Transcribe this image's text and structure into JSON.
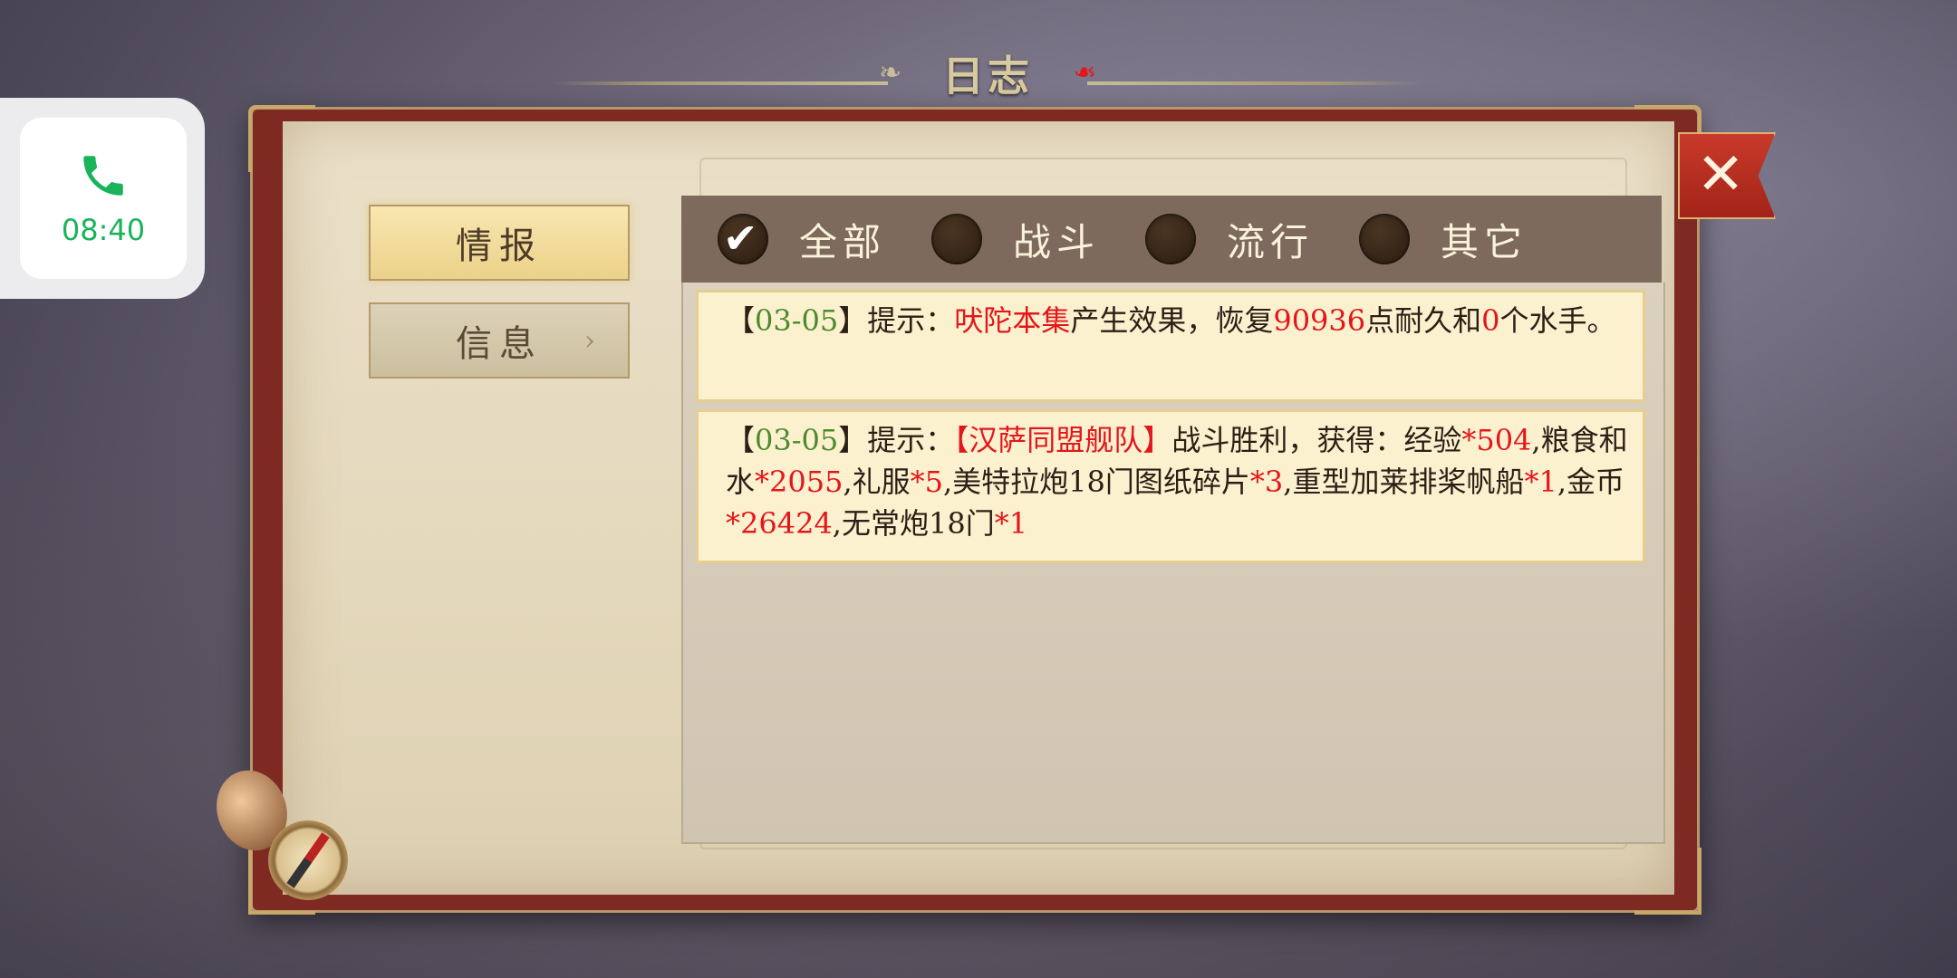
{
  "title": "日志",
  "call": {
    "time": "08:40"
  },
  "sidebar": {
    "tabs": [
      {
        "label": "情报",
        "active": true
      },
      {
        "label": "信息",
        "active": false
      }
    ]
  },
  "filters": [
    {
      "label": "全部",
      "checked": true
    },
    {
      "label": "战斗",
      "checked": false
    },
    {
      "label": "流行",
      "checked": false
    },
    {
      "label": "其它",
      "checked": false
    }
  ],
  "logs": {
    "entry1": {
      "open": "【",
      "date": "03-05",
      "close": "】",
      "prefix": "提示：",
      "item": "吠陀本集",
      "text1": "产生效果，恢复",
      "num1": "90936",
      "text2": "点耐久和",
      "num2": "0",
      "text3": "个水手。"
    },
    "entry2": {
      "open": "【",
      "date": "03-05",
      "close": "】",
      "prefix": "提示：",
      "fleet": "【汉萨同盟舰队】",
      "t1": "战斗胜利，获得：经验",
      "v1": "*504",
      "t2": ",粮食和水",
      "v2": "*2055",
      "t3": ",礼服",
      "v3": "*5",
      "t4": ",美特拉炮18门图纸碎片",
      "v4": "*3",
      "t5": ",重型加莱排桨帆船",
      "v5": "*1",
      "t6": ",金币",
      "v6": "*26424",
      "t7": ",无常炮18门",
      "v7": "*1"
    }
  },
  "colors": {
    "highlight_red": "#e3161b",
    "date_green": "#4d8a2e",
    "call_green": "#19b35a"
  },
  "icons": {
    "call": "phone-icon",
    "close": "close-icon",
    "check": "checkmark-icon",
    "chevron": "chevron-right-icon",
    "decor": "compass-icon"
  }
}
